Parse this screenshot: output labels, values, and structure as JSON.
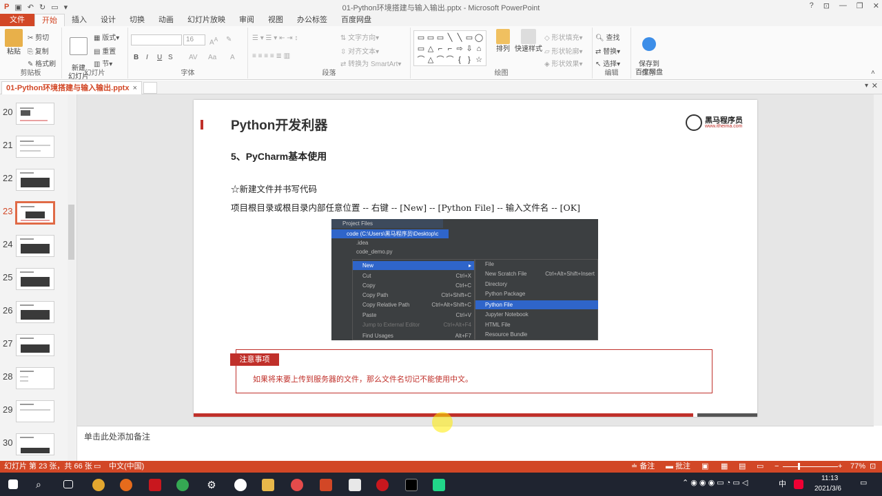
{
  "window": {
    "title": "01-Python环境搭建与输入输出.pptx - Microsoft PowerPoint",
    "controls": [
      "?",
      "⊡",
      "—",
      "❐",
      "✕"
    ]
  },
  "ribbon_tabs": [
    "文件",
    "开始",
    "插入",
    "设计",
    "切换",
    "动画",
    "幻灯片放映",
    "审阅",
    "视图",
    "办公标签",
    "百度网盘"
  ],
  "active_tab": "开始",
  "ribbon": {
    "clipboard": {
      "paste": "粘贴",
      "cut": "剪切",
      "copy": "复制",
      "format_painter": "格式刷",
      "label": "剪贴板"
    },
    "slides": {
      "new_slide": "新建\n幻灯片",
      "layout": "版式",
      "reset": "重置",
      "section": "节",
      "label": "幻灯片"
    },
    "font": {
      "size": "16",
      "bold": "B",
      "italic": "I",
      "underline": "U",
      "strike": "S",
      "spacing": "AV",
      "case": "Aa",
      "color": "A",
      "label": "字体"
    },
    "paragraph": {
      "text_direction": "文字方向",
      "align_text": "对齐文本",
      "smartart": "转换为 SmartArt",
      "label": "段落"
    },
    "drawing": {
      "arrange": "排列",
      "quick_styles": "快速样式",
      "shape_fill": "形状填充",
      "shape_outline": "形状轮廓",
      "shape_effects": "形状效果",
      "label": "绘图",
      "shapes": [
        "▭",
        "▭",
        "▭",
        "╲",
        "╲",
        "▭",
        "◯",
        "▭",
        "△",
        "⌐",
        "⌐",
        "⇨",
        "⇩",
        "⌂",
        "⌒",
        "△",
        "⌒",
        "⌒",
        "{",
        "}",
        "☆"
      ]
    },
    "editing": {
      "find": "查找",
      "replace": "替换",
      "select": "选择",
      "label": "编辑"
    },
    "save": {
      "save_baidu": "保存到\n百度网盘",
      "label": "保存"
    }
  },
  "doc_tab": {
    "label": "01-Python环境搭建与输入输出.pptx",
    "close": "×"
  },
  "thumbnails": [
    {
      "num": "20"
    },
    {
      "num": "21"
    },
    {
      "num": "22"
    },
    {
      "num": "23"
    },
    {
      "num": "24"
    },
    {
      "num": "25"
    },
    {
      "num": "26"
    },
    {
      "num": "27"
    },
    {
      "num": "28"
    },
    {
      "num": "29"
    },
    {
      "num": "30"
    }
  ],
  "selected_slide": "23",
  "slide": {
    "title": "Python开发利器",
    "logo_text": "黑马程序员",
    "logo_url": "www.itheima.com",
    "subtitle": "5、PyCharm基本使用",
    "bullet": "☆新建文件并书写代码",
    "path_text": "项目根目录或根目录内部任意位置 -- 右键 -- [New] -- [Python File] -- 输入文件名 -- [OK]",
    "note_head": "注意事项",
    "note_text": "如果将来要上传到服务器的文件，那么文件名切记不能使用中文。"
  },
  "screenshot": {
    "header": "Project Files",
    "code_row": "code (C:\\Users\\黑马程序员\\Desktop\\c",
    "idea_row": ".idea",
    "file_row": "code_demo.py",
    "menu": [
      {
        "label": "New",
        "shortcut": "▸"
      },
      {
        "label": "Cut",
        "shortcut": "Ctrl+X"
      },
      {
        "label": "Copy",
        "shortcut": "Ctrl+C"
      },
      {
        "label": "Copy Path",
        "shortcut": "Ctrl+Shift+C"
      },
      {
        "label": "Copy Relative Path",
        "shortcut": "Ctrl+Alt+Shift+C"
      },
      {
        "label": "Paste",
        "shortcut": "Ctrl+V"
      },
      {
        "label": "Jump to External Editor",
        "shortcut": "Ctrl+Alt+F4"
      },
      {
        "label": "Find Usages",
        "shortcut": "Alt+F7"
      }
    ],
    "submenu": [
      {
        "label": "File",
        "shortcut": ""
      },
      {
        "label": "New Scratch File",
        "shortcut": "Ctrl+Alt+Shift+Insert"
      },
      {
        "label": "Directory",
        "shortcut": ""
      },
      {
        "label": "Python Package",
        "shortcut": ""
      },
      {
        "label": "Python File",
        "shortcut": ""
      },
      {
        "label": "Jupyter Notebook",
        "shortcut": ""
      },
      {
        "label": "HTML File",
        "shortcut": ""
      },
      {
        "label": "Resource Bundle",
        "shortcut": ""
      }
    ]
  },
  "notes_placeholder": "单击此处添加备注",
  "status": {
    "slide_info": "幻灯片 第 23 张，共 66 张",
    "language": "中文(中国)",
    "notes": "备注",
    "comments": "批注",
    "zoom": "77%"
  },
  "taskbar": {
    "time": "11:13",
    "date": "2021/3/6",
    "ime": "中"
  },
  "colors": {
    "accent": "#d24726",
    "slide_red": "#c0302a"
  }
}
